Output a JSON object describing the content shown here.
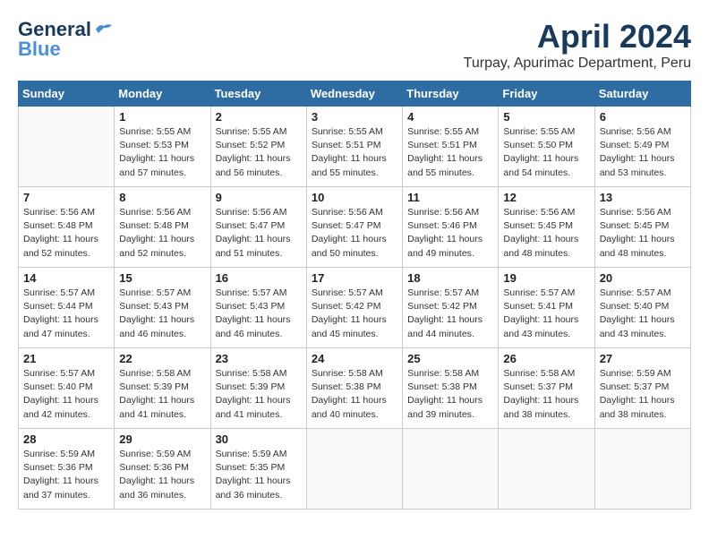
{
  "header": {
    "logo_general": "General",
    "logo_blue": "Blue",
    "month_title": "April 2024",
    "location": "Turpay, Apurimac Department, Peru"
  },
  "days_of_week": [
    "Sunday",
    "Monday",
    "Tuesday",
    "Wednesday",
    "Thursday",
    "Friday",
    "Saturday"
  ],
  "weeks": [
    [
      {
        "day": "",
        "info": ""
      },
      {
        "day": "1",
        "info": "Sunrise: 5:55 AM\nSunset: 5:53 PM\nDaylight: 11 hours\nand 57 minutes."
      },
      {
        "day": "2",
        "info": "Sunrise: 5:55 AM\nSunset: 5:52 PM\nDaylight: 11 hours\nand 56 minutes."
      },
      {
        "day": "3",
        "info": "Sunrise: 5:55 AM\nSunset: 5:51 PM\nDaylight: 11 hours\nand 55 minutes."
      },
      {
        "day": "4",
        "info": "Sunrise: 5:55 AM\nSunset: 5:51 PM\nDaylight: 11 hours\nand 55 minutes."
      },
      {
        "day": "5",
        "info": "Sunrise: 5:55 AM\nSunset: 5:50 PM\nDaylight: 11 hours\nand 54 minutes."
      },
      {
        "day": "6",
        "info": "Sunrise: 5:56 AM\nSunset: 5:49 PM\nDaylight: 11 hours\nand 53 minutes."
      }
    ],
    [
      {
        "day": "7",
        "info": ""
      },
      {
        "day": "8",
        "info": "Sunrise: 5:56 AM\nSunset: 5:48 PM\nDaylight: 11 hours\nand 52 minutes."
      },
      {
        "day": "9",
        "info": "Sunrise: 5:56 AM\nSunset: 5:47 PM\nDaylight: 11 hours\nand 51 minutes."
      },
      {
        "day": "10",
        "info": "Sunrise: 5:56 AM\nSunset: 5:47 PM\nDaylight: 11 hours\nand 50 minutes."
      },
      {
        "day": "11",
        "info": "Sunrise: 5:56 AM\nSunset: 5:46 PM\nDaylight: 11 hours\nand 49 minutes."
      },
      {
        "day": "12",
        "info": "Sunrise: 5:56 AM\nSunset: 5:45 PM\nDaylight: 11 hours\nand 48 minutes."
      },
      {
        "day": "13",
        "info": "Sunrise: 5:56 AM\nSunset: 5:45 PM\nDaylight: 11 hours\nand 48 minutes."
      }
    ],
    [
      {
        "day": "14",
        "info": ""
      },
      {
        "day": "15",
        "info": "Sunrise: 5:57 AM\nSunset: 5:43 PM\nDaylight: 11 hours\nand 46 minutes."
      },
      {
        "day": "16",
        "info": "Sunrise: 5:57 AM\nSunset: 5:43 PM\nDaylight: 11 hours\nand 46 minutes."
      },
      {
        "day": "17",
        "info": "Sunrise: 5:57 AM\nSunset: 5:42 PM\nDaylight: 11 hours\nand 45 minutes."
      },
      {
        "day": "18",
        "info": "Sunrise: 5:57 AM\nSunset: 5:42 PM\nDaylight: 11 hours\nand 44 minutes."
      },
      {
        "day": "19",
        "info": "Sunrise: 5:57 AM\nSunset: 5:41 PM\nDaylight: 11 hours\nand 43 minutes."
      },
      {
        "day": "20",
        "info": "Sunrise: 5:57 AM\nSunset: 5:40 PM\nDaylight: 11 hours\nand 43 minutes."
      }
    ],
    [
      {
        "day": "21",
        "info": ""
      },
      {
        "day": "22",
        "info": "Sunrise: 5:58 AM\nSunset: 5:39 PM\nDaylight: 11 hours\nand 41 minutes."
      },
      {
        "day": "23",
        "info": "Sunrise: 5:58 AM\nSunset: 5:39 PM\nDaylight: 11 hours\nand 41 minutes."
      },
      {
        "day": "24",
        "info": "Sunrise: 5:58 AM\nSunset: 5:38 PM\nDaylight: 11 hours\nand 40 minutes."
      },
      {
        "day": "25",
        "info": "Sunrise: 5:58 AM\nSunset: 5:38 PM\nDaylight: 11 hours\nand 39 minutes."
      },
      {
        "day": "26",
        "info": "Sunrise: 5:58 AM\nSunset: 5:37 PM\nDaylight: 11 hours\nand 38 minutes."
      },
      {
        "day": "27",
        "info": "Sunrise: 5:59 AM\nSunset: 5:37 PM\nDaylight: 11 hours\nand 38 minutes."
      }
    ],
    [
      {
        "day": "28",
        "info": "Sunrise: 5:59 AM\nSunset: 5:36 PM\nDaylight: 11 hours\nand 37 minutes."
      },
      {
        "day": "29",
        "info": "Sunrise: 5:59 AM\nSunset: 5:36 PM\nDaylight: 11 hours\nand 36 minutes."
      },
      {
        "day": "30",
        "info": "Sunrise: 5:59 AM\nSunset: 5:35 PM\nDaylight: 11 hours\nand 36 minutes."
      },
      {
        "day": "",
        "info": ""
      },
      {
        "day": "",
        "info": ""
      },
      {
        "day": "",
        "info": ""
      },
      {
        "day": "",
        "info": ""
      }
    ]
  ],
  "week1_day7_info": "Sunrise: 5:56 AM\nSunset: 5:48 PM\nDaylight: 11 hours\nand 52 minutes.",
  "week1_day14_info": "Sunrise: 5:57 AM\nSunset: 5:44 PM\nDaylight: 11 hours\nand 47 minutes.",
  "week1_day21_info": "Sunrise: 5:57 AM\nSunset: 5:40 PM\nDaylight: 11 hours\nand 42 minutes."
}
